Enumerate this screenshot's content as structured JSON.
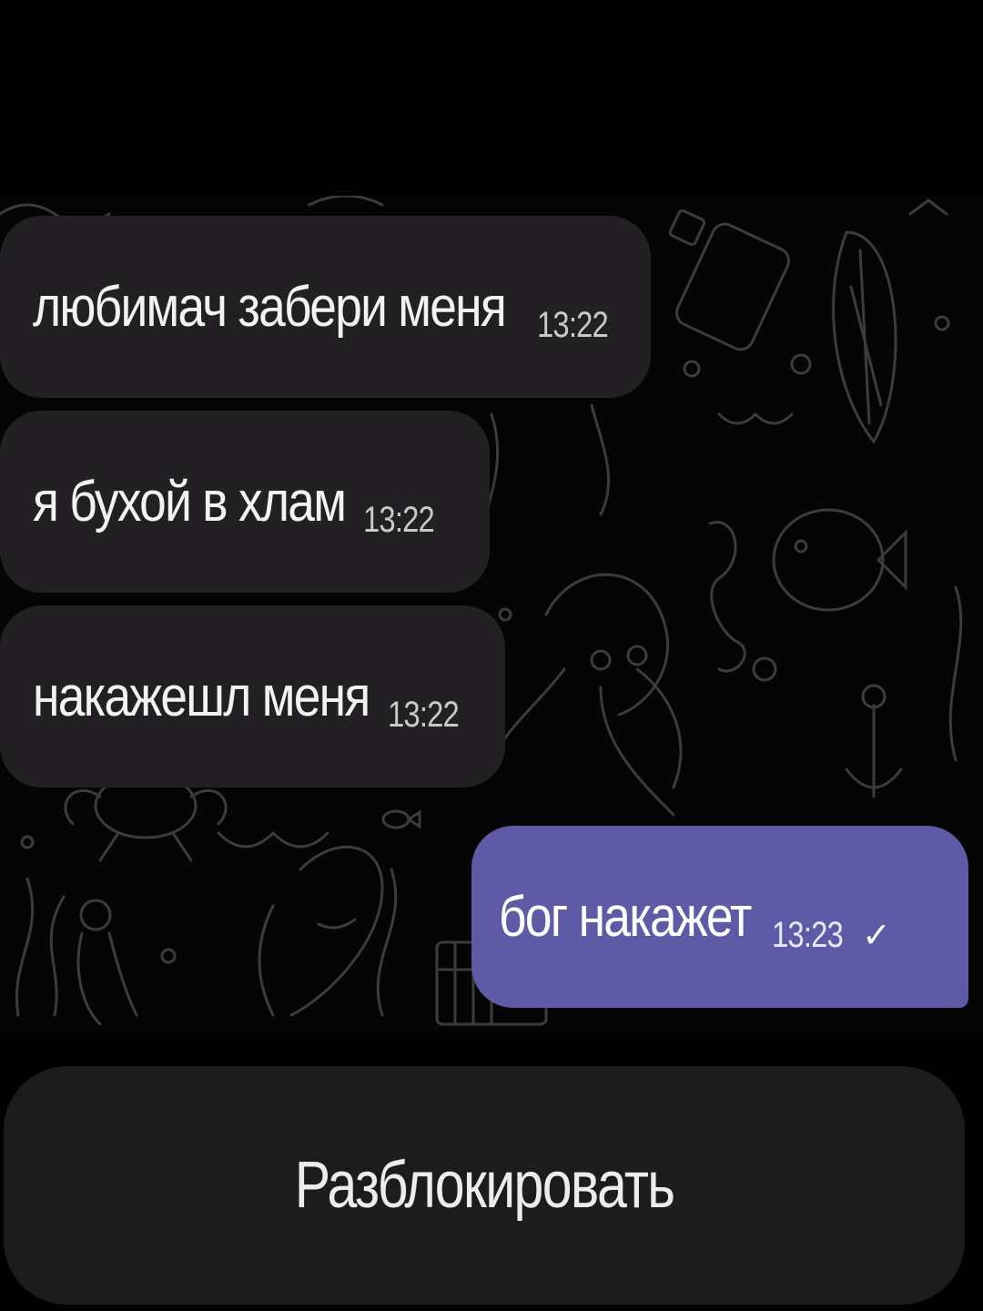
{
  "chat": {
    "messages": [
      {
        "direction": "incoming",
        "text": "любимач забери меня",
        "time": "13:22"
      },
      {
        "direction": "incoming",
        "text": "я бухой в хлам",
        "time": "13:22"
      },
      {
        "direction": "incoming",
        "text": "накажешл меня",
        "time": "13:22"
      },
      {
        "direction": "outgoing",
        "text": "бог накажет",
        "time": "13:23",
        "status": "✓"
      }
    ]
  },
  "footer": {
    "unblock_label": "Разблокировать"
  },
  "colors": {
    "background": "#000000",
    "incoming_bubble": "#222023",
    "outgoing_bubble": "#5e5aa6",
    "button": "#1c1c1c",
    "wallpaper_lines": "#3a3a3a"
  },
  "icons": {
    "wallpaper": "sea-doodle-pattern",
    "read_status": "checkmark-icon"
  }
}
